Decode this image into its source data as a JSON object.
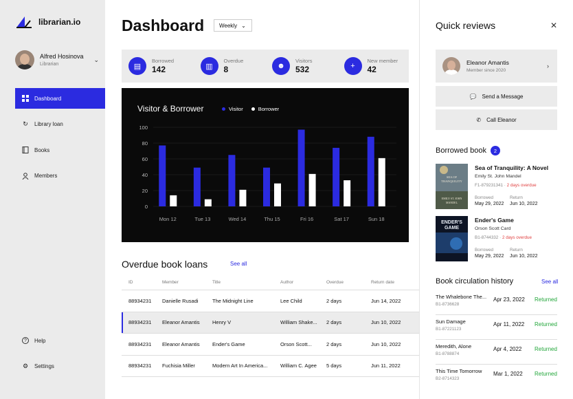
{
  "app": {
    "name": "librarian.io"
  },
  "user": {
    "name": "Alfred Hosinova",
    "role": "Librarian"
  },
  "sidebar": {
    "items": [
      {
        "label": "Dashboard",
        "icon": "grid-icon"
      },
      {
        "label": "Library loan",
        "icon": "refresh-icon"
      },
      {
        "label": "Books",
        "icon": "book-icon"
      },
      {
        "label": "Members",
        "icon": "user-icon"
      }
    ],
    "bottom": [
      {
        "label": "Help",
        "icon": "help-icon"
      },
      {
        "label": "Settings",
        "icon": "gear-icon"
      }
    ]
  },
  "header": {
    "title": "Dashboard",
    "period": "Weekly"
  },
  "stats": [
    {
      "label": "Borrowed",
      "value": "142"
    },
    {
      "label": "Overdue",
      "value": "8"
    },
    {
      "label": "Visitors",
      "value": "532"
    },
    {
      "label": "New member",
      "value": "42"
    }
  ],
  "chart_data": {
    "type": "bar",
    "title": "Visitor & Borrower",
    "categories": [
      "Mon 12",
      "Tue 13",
      "Wed 14",
      "Thu 15",
      "Fri 16",
      "Sat 17",
      "Sun 18"
    ],
    "series": [
      {
        "name": "Visitor",
        "values": [
          77,
          49,
          65,
          49,
          97,
          74,
          88
        ],
        "color": "#2b2be0"
      },
      {
        "name": "Borrower",
        "values": [
          14,
          9,
          21,
          29,
          41,
          33,
          61
        ],
        "color": "#ffffff"
      }
    ],
    "ylim": [
      0,
      100
    ],
    "yticks": [
      0,
      20,
      40,
      60,
      80,
      100
    ],
    "grid": true,
    "legend": "top"
  },
  "overdue": {
    "title": "Overdue book loans",
    "see_all": "See all",
    "columns": [
      "ID",
      "Member",
      "Title",
      "Author",
      "Overdue",
      "Return date"
    ],
    "rows": [
      [
        "88934231",
        "Danielle Rusadi",
        "The Midnight Line",
        "Lee Child",
        "2 days",
        "Jun 14, 2022"
      ],
      [
        "88934231",
        "Eleanor Amantis",
        "Henry V",
        "William Shake...",
        "2 days",
        "Jun 10, 2022"
      ],
      [
        "88934231",
        "Eleanor Amantis",
        "Ender's Game",
        "Orson Scott...",
        "2 days",
        "Jun 10, 2022"
      ],
      [
        "88934231",
        "Fuchisia Miller",
        "Modern Art In America...",
        "William C. Agee",
        "5 days",
        "Jun 11, 2022"
      ]
    ]
  },
  "panel": {
    "title": "Quick reviews",
    "reviewer": {
      "name": "Eleanor Amantis",
      "since": "Member since 2020"
    },
    "send_message": "Send a Message",
    "call": "Call Eleanor",
    "borrowed_title": "Borrowed book",
    "borrowed_count": "2",
    "books": [
      {
        "title": "Sea of Tranquility: A Novel",
        "author": "Emily St. John Mandel",
        "id": "F1-879231341",
        "overdue": "2 days overdue",
        "borrowed_label": "Borrowed",
        "borrowed": "May 29, 2022",
        "return_label": "Return",
        "return": "Jun 10, 2022",
        "cover_lines": [
          "SEA OF",
          "TRANQUILITY",
          "EMILY ST. JOHN",
          "MANDEL"
        ]
      },
      {
        "title": "Ender's Game",
        "author": "Orson Scott Card",
        "id": "B1-8744332",
        "overdue": "2 days overdue",
        "borrowed_label": "Borrowed",
        "borrowed": "May 29, 2022",
        "return_label": "Return",
        "return": "Jun 10, 2022",
        "cover_lines": [
          "ENDER'S",
          "GAME"
        ]
      }
    ],
    "history_title": "Book circulation history",
    "history_see_all": "See all",
    "history": [
      {
        "title": "The Whalebone The...",
        "id": "B1-8736628",
        "date": "Apr 23, 2022",
        "status": "Returned"
      },
      {
        "title": "Sun Damage",
        "id": "B1-87221123",
        "date": "Apr 11, 2022",
        "status": "Returned"
      },
      {
        "title": "Meredith, Alone",
        "id": "B1-8788874",
        "date": "Apr 4, 2022",
        "status": "Returned"
      },
      {
        "title": "This Time Tomorrow",
        "id": "B2-8714323",
        "date": "Mar 1, 2022",
        "status": "Returned"
      }
    ]
  }
}
